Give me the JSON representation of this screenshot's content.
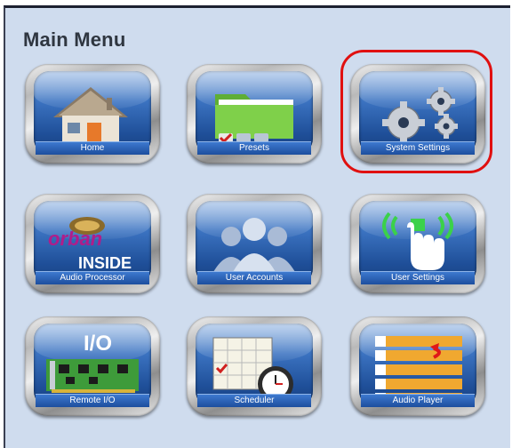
{
  "header": {
    "title": "Main Menu"
  },
  "tiles": [
    {
      "label": "Home",
      "icon": "house-icon"
    },
    {
      "label": "Presets",
      "icon": "folder-icon"
    },
    {
      "label": "System Settings",
      "icon": "gears-icon"
    },
    {
      "label": "Audio Processor",
      "icon": "orban-inside-icon"
    },
    {
      "label": "User Accounts",
      "icon": "users-icon"
    },
    {
      "label": "User Settings",
      "icon": "touch-wireless-icon"
    },
    {
      "label": "Remote I/O",
      "icon": "circuit-board-icon"
    },
    {
      "label": "Scheduler",
      "icon": "calendar-clock-icon"
    },
    {
      "label": "Audio Player",
      "icon": "playlist-icon"
    }
  ],
  "art": {
    "orban_text": "orban",
    "inside_text": "INSIDE",
    "io_text": "I/O"
  },
  "colors": {
    "panel_bg": "#cfdcee",
    "tile_blue": "#2a5fae",
    "highlight": "#e01010"
  },
  "highlighted_tile": "System Settings"
}
